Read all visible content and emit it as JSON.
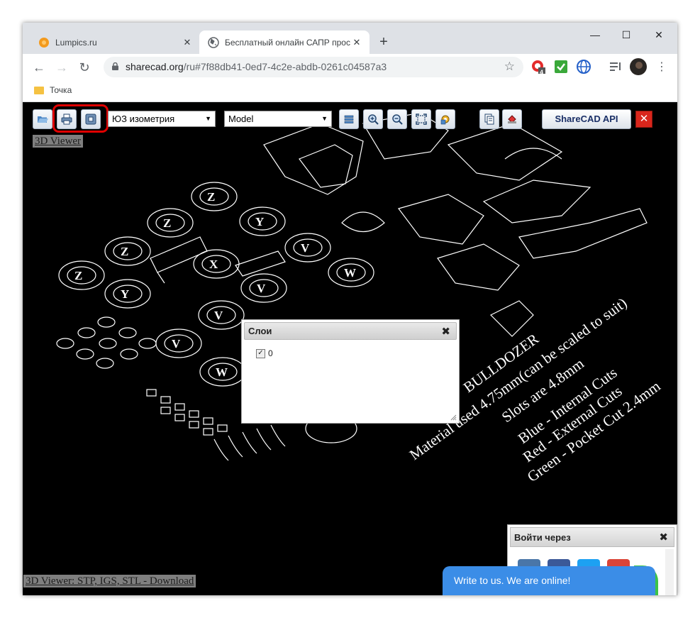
{
  "browser": {
    "tabs": [
      {
        "title": "Lumpics.ru",
        "active": false
      },
      {
        "title": "Бесплатный онлайн САПР прос",
        "active": true
      }
    ],
    "url_host": "sharecad.org",
    "url_path": "/ru#7f88db41-0ed7-4c2e-abdb-0261c04587a3",
    "bookmark": "Точка",
    "extension_badge": "4"
  },
  "sharecad": {
    "view_select": "ЮЗ изометрия",
    "layout_select": "Model",
    "api_button": "ShareCAD API",
    "viewer_link_top": "3D Viewer",
    "viewer_link_bottom": "3D Viewer: STP, IGS, STL - Download",
    "accent": "#e00000"
  },
  "layers_dialog": {
    "title": "Слои",
    "layer_name": "0",
    "layer_checked": true
  },
  "login_widget": {
    "title": "Войти через"
  },
  "chat": {
    "text": "Write to us. We are online!"
  },
  "drawing": {
    "line1": "BULLDOZER",
    "line2": "Material used 4.75mm(can be scaled to suit)",
    "line3": "Slots are 4.8mm",
    "line4": "Blue - Internal Cuts",
    "line5": "Red - External Cuts",
    "line6": "Green - Pocket Cut 2.4mm"
  }
}
